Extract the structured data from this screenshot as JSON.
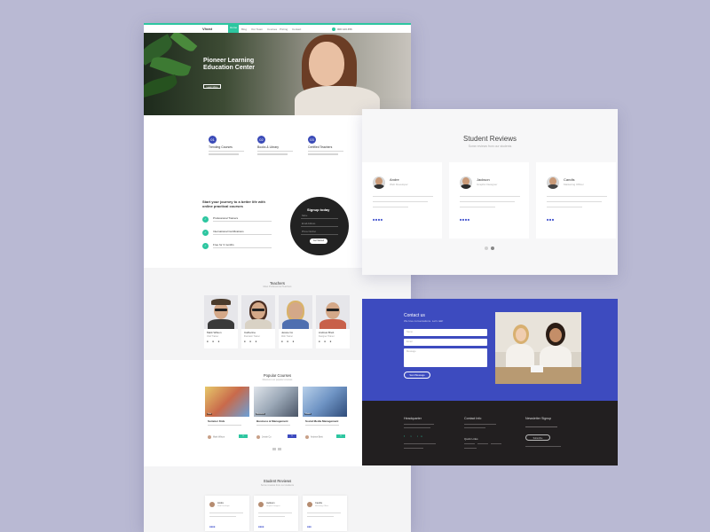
{
  "main": {
    "logo": "Vhost",
    "nav": [
      "Home",
      "Blog",
      "Our Team",
      "Courses",
      "Pricing",
      "Contact"
    ],
    "phone": "000 123 456",
    "hero": {
      "title": "Pioneer Learning Education Center",
      "button": "Learn More"
    },
    "features": [
      {
        "icon": "01",
        "title": "Trending Courses"
      },
      {
        "icon": "02",
        "title": "Books & Library"
      },
      {
        "icon": "03",
        "title": "Certified Teachers"
      }
    ],
    "journey": {
      "title": "Start your journey to a better life with online practical courses",
      "items": [
        {
          "title": "Professional Trainers"
        },
        {
          "title": "International Certifications"
        },
        {
          "title": "Free for 3 months"
        }
      ]
    },
    "signup": {
      "title": "Signup today",
      "fields": [
        "Name",
        "Email Address",
        "Phone Number"
      ],
      "button": "Get Started"
    },
    "teachers": {
      "title": "Teachers",
      "subtitle": "Meet Professional Teachers",
      "items": [
        {
          "name": "Mark Wilson",
          "role": "Chef Trainer"
        },
        {
          "name": "Catherine",
          "role": "Illustrator Trainer"
        },
        {
          "name": "Jessie Co",
          "role": "Web Trainer"
        },
        {
          "name": "Andrew Brett",
          "role": "Designer Trainer"
        }
      ]
    },
    "courses": {
      "title": "Popular Courses",
      "subtitle": "Discover our popular courses",
      "items": [
        {
          "title": "Summer Kids",
          "author": "Mark Wilson",
          "badge": "Kids",
          "price_color": "#2dc6a0"
        },
        {
          "title": "Business & Management",
          "author": "Jessie Co",
          "badge": "Business",
          "price_color": "#3d4bbf"
        },
        {
          "title": "Social Media Management",
          "author": "Andrew Brett",
          "badge": "Media",
          "price_color": "#2dc6a0"
        }
      ]
    },
    "reviews": {
      "title": "Student Reviews",
      "subtitle": "Some reviews from our students",
      "items": [
        {
          "name": "Andre",
          "role": "Web Developer"
        },
        {
          "name": "Jackson",
          "role": "Graphic Designer"
        },
        {
          "name": "Candis",
          "role": "Marketing Officer"
        }
      ]
    }
  },
  "reviews_card": {
    "title": "Student Reviews",
    "subtitle": "Some reviews from our students",
    "items": [
      {
        "name": "Andre",
        "role": "Web Developer",
        "stars": "■■■■"
      },
      {
        "name": "Jackson",
        "role": "Graphic Designer",
        "stars": "■■■■"
      },
      {
        "name": "Candis",
        "role": "Marketing Officer",
        "stars": "■■■"
      }
    ]
  },
  "contact": {
    "title": "Contact us",
    "subtitle": "We love conversations. Let's talk!",
    "placeholders": [
      "Name",
      "Email",
      "Message"
    ],
    "button": "Send Message"
  },
  "footer": {
    "headquarters": "Headquarter",
    "contact_info": "Contact Info",
    "quick_links": "Quick Links",
    "newsletter": "Newsletter Signup",
    "subscribe": "Subscribe",
    "social": "f t in"
  },
  "colors": {
    "accent": "#2dc6a0",
    "brand": "#3d4bbf",
    "dark": "#221f20"
  }
}
